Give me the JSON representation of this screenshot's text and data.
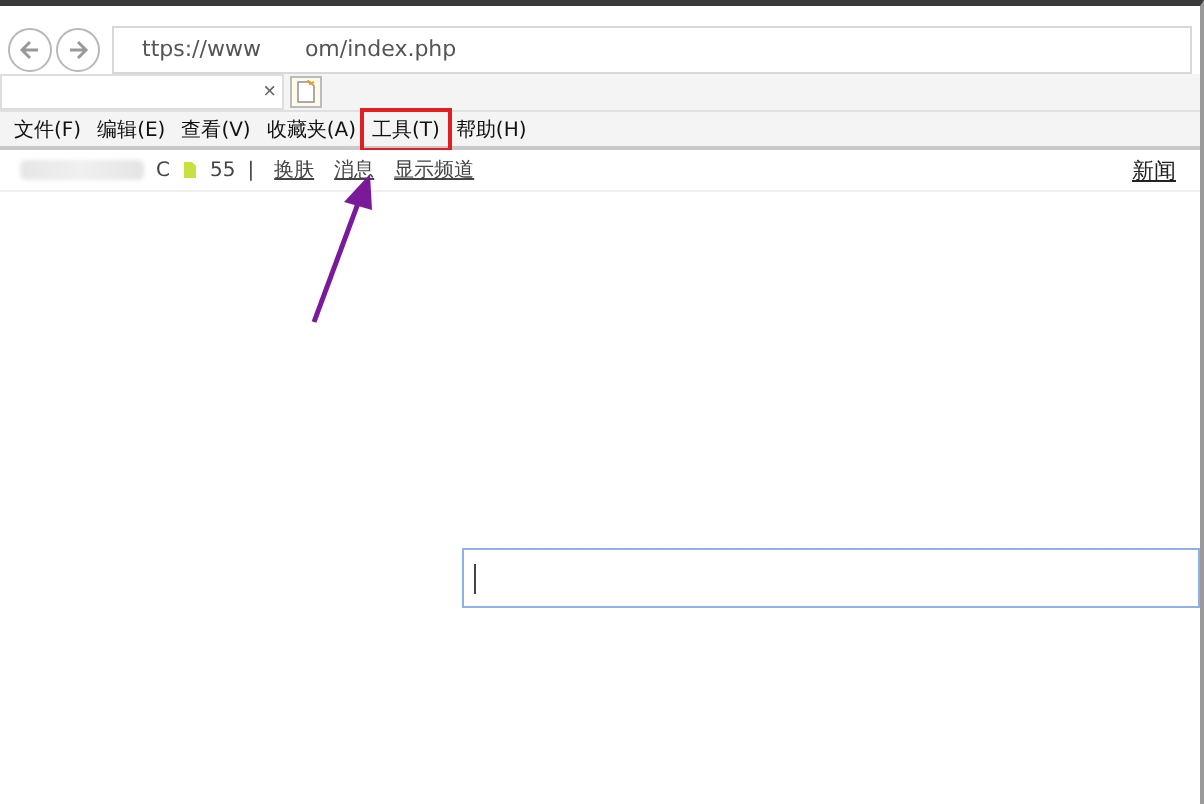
{
  "address_bar": {
    "url_start": "ttps://www",
    "url_end": "om/index.php"
  },
  "tab": {
    "close": "×"
  },
  "menu": [
    {
      "label": "文件(F)",
      "highlighted": false
    },
    {
      "label": "编辑(E)",
      "highlighted": false
    },
    {
      "label": "查看(V)",
      "highlighted": false
    },
    {
      "label": "收藏夹(A)",
      "highlighted": false
    },
    {
      "label": "工具(T)",
      "highlighted": true
    },
    {
      "label": "帮助(H)",
      "highlighted": false
    }
  ],
  "site_bar": {
    "user_suffix": "C",
    "points": "55",
    "separator": "|",
    "links": [
      "换肤",
      "消息",
      "显示频道"
    ],
    "right_link": "新闻"
  },
  "search": {
    "focused": true
  }
}
